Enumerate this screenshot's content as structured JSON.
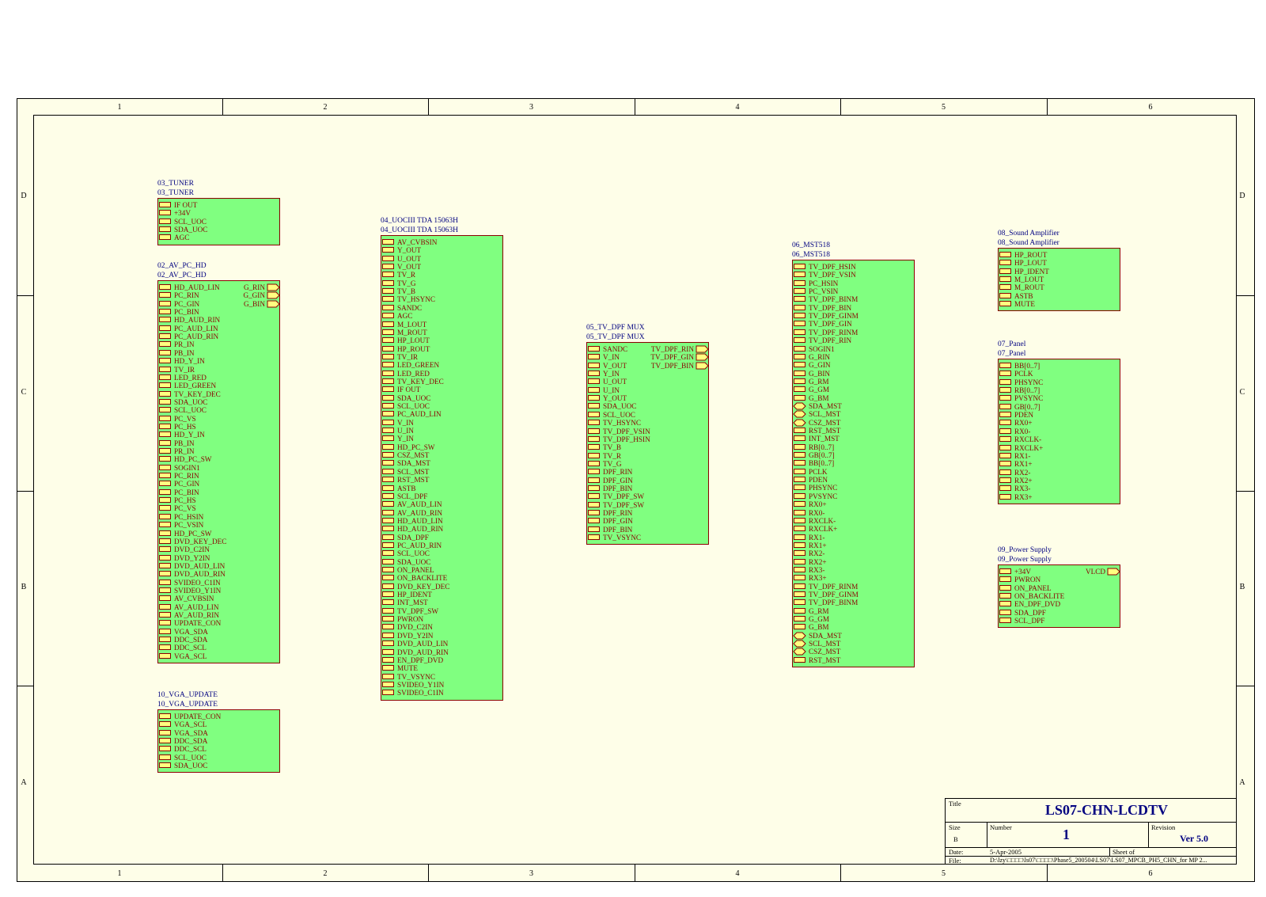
{
  "zones": {
    "columns": [
      "1",
      "2",
      "3",
      "4",
      "5",
      "6"
    ],
    "rows": [
      "D",
      "C",
      "B",
      "A"
    ]
  },
  "colors": {
    "block_fill": "#80ff80",
    "block_border": "#8b0000",
    "port_fill": "#ffff80",
    "label": "#000080",
    "paper": "#fefee8"
  },
  "blocks": {
    "tuner": {
      "name": "03_TUNER",
      "file": "03_TUNER",
      "pins": [
        "IF OUT",
        "+34V",
        "SCL_UOC",
        "SDA_UOC",
        "AGC"
      ],
      "right_pins": []
    },
    "av_pc_hd": {
      "name": "02_AV_PC_HD",
      "file": "02_AV_PC_HD",
      "pins": [
        "HD_AUD_LIN",
        "PC_RIN",
        "PC_GIN",
        "PC_BIN",
        "HD_AUD_RIN",
        "PC_AUD_LIN",
        "PC_AUD_RIN",
        "PR_IN",
        "PB_IN",
        "HD_Y_IN",
        "TV_IR",
        "LED_RED",
        "LED_GREEN",
        "TV_KEY_DEC",
        "SDA_UOC",
        "SCL_UOC",
        "PC_VS",
        "PC_HS",
        "HD_Y_IN",
        "PB_IN",
        "PR_IN",
        "HD_PC_SW",
        "SOGIN1",
        "PC_RIN",
        "PC_GIN",
        "PC_BIN",
        "PC_HS",
        "PC_VS",
        "PC_HSIN",
        "PC_VSIN",
        "HD_PC_SW",
        "DVD_KEY_DEC",
        "DVD_C2IN",
        "DVD_Y2IN",
        "DVD_AUD_LIN",
        "DVD_AUD_RIN",
        "SVIDEO_C1IN",
        "SVIDEO_Y1IN",
        "AV_CVBSIN",
        "AV_AUD_LIN",
        "AV_AUD_RIN",
        "UPDATE_CON",
        "VGA_SDA",
        "DDC_SDA",
        "DDC_SCL",
        "VGA_SCL"
      ],
      "right_pins": [
        "G_RIN",
        "G_GIN",
        "G_BIN"
      ]
    },
    "vga_update": {
      "name": "10_VGA_UPDATE",
      "file": "10_VGA_UPDATE",
      "pins": [
        "UPDATE_CON",
        "VGA_SCL",
        "VGA_SDA",
        "DDC_SDA",
        "DDC_SCL",
        "SCL_UOC",
        "SDA_UOC"
      ],
      "right_pins": []
    },
    "uociii": {
      "name": "04_UOCIII TDA 15063H",
      "file": "04_UOCIII TDA 15063H",
      "pins": [
        "AV_CVBSIN",
        "Y_OUT",
        "U_OUT",
        "V_OUT",
        "TV_R",
        "TV_G",
        "TV_B",
        "TV_HSYNC",
        "SANDC",
        "AGC",
        "M_LOUT",
        "M_ROUT",
        "HP_LOUT",
        "HP_ROUT",
        "TV_IR",
        "LED_GREEN",
        "LED_RED",
        "TV_KEY_DEC",
        "IF OUT",
        "SDA_UOC",
        "SCL_UOC",
        "PC_AUD_LIN",
        "V_IN",
        "U_IN",
        "Y_IN",
        "HD_PC_SW",
        "CSZ_MST",
        "SDA_MST",
        "SCL_MST",
        "RST_MST",
        "ASTB",
        "SCL_DPF",
        "AV_AUD_LIN",
        "AV_AUD_RIN",
        "HD_AUD_LIN",
        "HD_AUD_RIN",
        "SDA_DPF",
        "PC_AUD_RIN",
        "SCL_UOC",
        "SDA_UOC",
        "ON_PANEL",
        "ON_BACKLITE",
        "DVD_KEY_DEC",
        "HP_IDENT",
        "INT_MST",
        "TV_DPF_SW",
        "PWRON",
        "DVD_C2IN",
        "DVD_Y2IN",
        "DVD_AUD_LIN",
        "DVD_AUD_RIN",
        "EN_DPF_DVD",
        "MUTE",
        "TV_VSYNC",
        "SVIDEO_Y1IN",
        "SVIDEO_C1IN"
      ],
      "right_pins": []
    },
    "tv_dpf_mux": {
      "name": "05_TV_DPF MUX",
      "file": "05_TV_DPF MUX",
      "pins": [
        "SANDC",
        "V_IN",
        "V_OUT",
        "Y_IN",
        "U_OUT",
        "U_IN",
        "Y_OUT",
        "SDA_UOC",
        "SCL_UOC",
        "TV_HSYNC",
        "TV_DPF_VSIN",
        "TV_DPF_HSIN",
        "TV_B",
        "TV_R",
        "TV_G",
        "DPF_RIN",
        "DPF_GIN",
        "DPF_BIN",
        "TV_DPF_SW",
        "TV_DPF_SW",
        "DPF_RIN",
        "DPF_GIN",
        "DPF_BIN",
        "TV_VSYNC"
      ],
      "right_pins": [
        "TV_DPF_RIN",
        "TV_DPF_GIN",
        "TV_DPF_BIN"
      ]
    },
    "mst518": {
      "name": "06_MST518",
      "file": "06_MST518",
      "pins": [
        "TV_DPF_HSIN",
        "TV_DPF_VSIN",
        "PC_HSIN",
        "PC_VSIN",
        "TV_DPF_BINM",
        "TV_DPF_BIN",
        "TV_DPF_GINM",
        "TV_DPF_GIN",
        "TV_DPF_RINM",
        "TV_DPF_RIN",
        "SOGIN1",
        "G_RIN",
        "G_GIN",
        "G_BIN",
        "G_RM",
        "G_GM",
        "G_BM",
        "SDA_MST",
        "SCL_MST",
        "CSZ_MST",
        "RST_MST",
        "INT_MST",
        "RB[0..7]",
        "GB[0..7]",
        "BB[0..7]",
        "PCLK",
        "PDEN",
        "PHSYNC",
        "PVSYNC",
        "RX0+",
        "RX0-",
        "RXCLK-",
        "RXCLK+",
        "RX1-",
        "RX1+",
        "RX2-",
        "RX2+",
        "RX3-",
        "RX3+",
        "TV_DPF_RINM",
        "TV_DPF_GINM",
        "TV_DPF_BINM",
        "G_RM",
        "G_GM",
        "G_BM",
        "SDA_MST",
        "SCL_MST",
        "CSZ_MST",
        "RST_MST"
      ],
      "right_pins": []
    },
    "sound_amp": {
      "name": "08_Sound Amplifier",
      "file": "08_Sound Amplifier",
      "pins": [
        "HP_ROUT",
        "HP_LOUT",
        "HP_IDENT",
        "M_LOUT",
        "M_ROUT",
        "ASTB",
        "MUTE"
      ],
      "right_pins": []
    },
    "panel": {
      "name": "07_Panel",
      "file": "07_Panel",
      "pins": [
        "BB[0..7]",
        "PCLK",
        "PHSYNC",
        "RB[0..7]",
        "PVSYNC",
        "GB[0..7]",
        "PDEN",
        "RX0+",
        "RX0-",
        "RXCLK-",
        "RXCLK+",
        "RX1-",
        "RX1+",
        "RX2-",
        "RX2+",
        "RX3-",
        "RX3+"
      ],
      "right_pins": []
    },
    "power": {
      "name": "09_Power Supply",
      "file": "09_Power Supply",
      "pins": [
        "+34V",
        "PWRON",
        "ON_PANEL",
        "ON_BACKLITE",
        "EN_DPF_DVD",
        "SDA_DPF",
        "SCL_DPF"
      ],
      "right_pins": [
        "VLCD"
      ]
    }
  },
  "title_block": {
    "title_label": "Title",
    "title": "LS07-CHN-LCDTV",
    "size_label": "Size",
    "size": "B",
    "number_label": "Number",
    "number": "1",
    "revision_label": "Revision",
    "revision": "Ver 5.0",
    "date_label": "Date:",
    "date": "5-Apr-2005",
    "sheet_label": "Sheet    of",
    "file_label": "File:",
    "file": "D:\\lzy\\□□□□\\ls07\\□□□□\\Phase5_200504\\LS07\\LS07_MPCB_PH5_CHN_for MP 2..."
  }
}
